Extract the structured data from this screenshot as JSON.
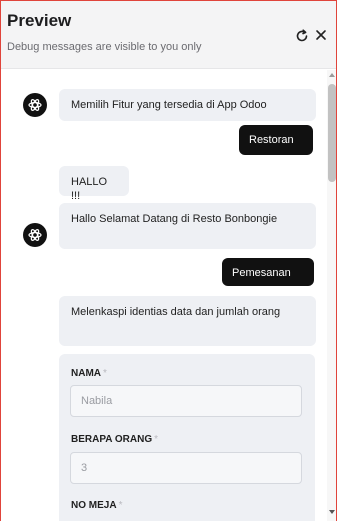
{
  "header": {
    "title": "Preview",
    "subtitle": "Debug messages are visible to you only",
    "refresh_icon": "refresh-icon",
    "close_icon": "close-icon"
  },
  "messages": [
    {
      "sender": "bot",
      "text": "Memilih Fitur yang tersedia di App Odoo"
    },
    {
      "sender": "user",
      "text": "Restoran"
    },
    {
      "sender": "bot",
      "text": "HALLO !!!"
    },
    {
      "sender": "bot",
      "text": "Hallo Selamat Datang di Resto Bonbongie"
    },
    {
      "sender": "user",
      "text": "Pemesanan"
    },
    {
      "sender": "bot",
      "text": "Melenkaspi identias data dan jumlah orang"
    }
  ],
  "form": {
    "fields": [
      {
        "label": "NAMA",
        "required_mark": "*",
        "placeholder": "Nabila"
      },
      {
        "label": "BERAPA ORANG",
        "required_mark": "*",
        "placeholder": "3"
      },
      {
        "label": "NO MEJA",
        "required_mark": "*",
        "placeholder": ""
      }
    ]
  },
  "colors": {
    "accent_border": "#e0443b",
    "user_bubble": "#111111",
    "bot_bubble": "#eef0f4"
  }
}
